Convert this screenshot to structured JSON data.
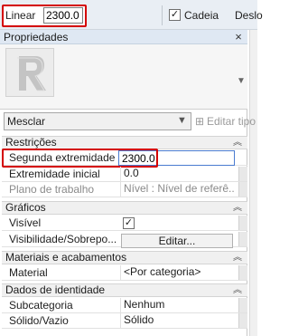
{
  "options_bar": {
    "linear_label": "Linear",
    "linear_value": "2300.0",
    "chain_label": "Cadeia",
    "chain_checked": "✓",
    "next_label": "Deslo"
  },
  "panel": {
    "title": "Propriedades",
    "close_symbol": "×",
    "type_name": "Mesclar",
    "edit_type_label": "Editar tipo"
  },
  "sections": {
    "constraints": {
      "title": "Restrições",
      "rows": [
        {
          "name": "Segunda extremidade",
          "value": "2300.0"
        },
        {
          "name": "Extremidade inicial",
          "value": "0.0"
        },
        {
          "name": "Plano de trabalho",
          "value": "Nível : Nível de referê..."
        }
      ]
    },
    "graphics": {
      "title": "Gráficos",
      "rows": [
        {
          "name": "Visível",
          "value": "✓"
        },
        {
          "name": "Visibilidade/Sobrepo...",
          "value": "Editar..."
        }
      ]
    },
    "materials": {
      "title": "Materiais e acabamentos",
      "rows": [
        {
          "name": "Material",
          "value": "<Por categoria>"
        }
      ]
    },
    "identity": {
      "title": "Dados de identidade",
      "rows": [
        {
          "name": "Subcategoria",
          "value": "Nenhum"
        },
        {
          "name": "Sólido/Vazio",
          "value": "Sólido"
        }
      ]
    }
  },
  "icons": {
    "type_thumbnail": "revit-r-logo-icon",
    "edit_type": "edit-type-icon",
    "collapse": "chevron-up-double-icon"
  },
  "colors": {
    "highlight": "#d40000",
    "section_bg": "#f0f0f0",
    "title_bg": "#dfe8f3"
  }
}
